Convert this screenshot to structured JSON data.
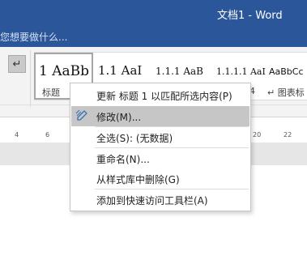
{
  "window": {
    "title": "文档1 - Word"
  },
  "tell_me": {
    "placeholder": "您想要做什么..."
  },
  "colors": {
    "title_bar": "#2b579a",
    "menu_highlight": "#c6c6c6",
    "ribbon_background": "#f3f3f3"
  },
  "ribbon": {
    "left_button_icon": "paragraph-mark-icon",
    "styles": [
      {
        "preview": "1  AaBb",
        "name": "标题",
        "selected": true
      },
      {
        "preview": "1.1  AaI",
        "name": ""
      },
      {
        "preview": "1.1.1  AaB",
        "name": ""
      },
      {
        "preview": "1.1.1.1  AaI",
        "name": "4"
      },
      {
        "preview": "AaBbCc",
        "name": "↵ 图表标"
      }
    ]
  },
  "ruler": {
    "labels": [
      "4",
      "6",
      "20",
      "22"
    ]
  },
  "context_menu": {
    "items": [
      {
        "label": "更新 标题 1 以匹配所选内容(P)",
        "icon": ""
      },
      {
        "label": "修改(M)...",
        "icon": "modify-style-icon",
        "highlighted": true
      },
      {
        "label": "全选(S): (无数据)",
        "icon": ""
      },
      {
        "label": "重命名(N)...",
        "icon": ""
      },
      {
        "label": "从样式库中删除(G)",
        "icon": ""
      },
      {
        "label": "添加到快速访问工具栏(A)",
        "icon": ""
      }
    ]
  }
}
